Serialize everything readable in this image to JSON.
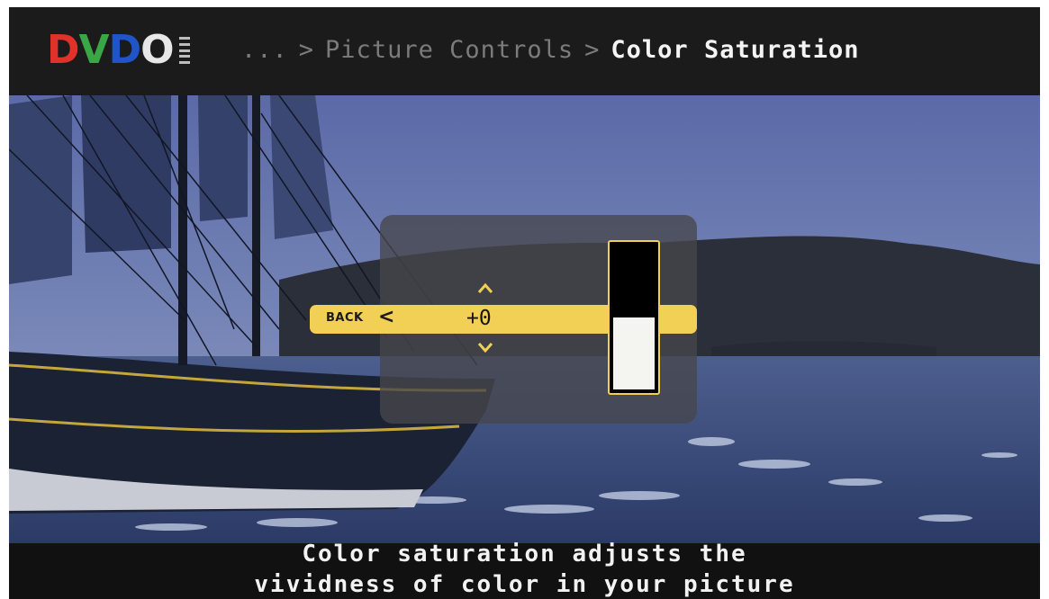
{
  "header": {
    "logo": {
      "letters": [
        {
          "char": "D",
          "color": "#e0312b"
        },
        {
          "char": "V",
          "color": "#3aa646"
        },
        {
          "char": "D",
          "color": "#1f55c9"
        },
        {
          "char": "O",
          "color": "#e8e8e8"
        }
      ]
    },
    "breadcrumb": {
      "ellipsis": "...",
      "separator": ">",
      "parent": "Picture Controls",
      "current": "Color Saturation"
    }
  },
  "dialog": {
    "back_label": "BACK",
    "back_icon": "chevron-left-icon",
    "value": "+0",
    "up_icon": "chevron-up-icon",
    "down_icon": "chevron-down-icon",
    "level_fraction": 0.5,
    "accent_color": "#f2cf55"
  },
  "caption": {
    "line1": "Color saturation adjusts the",
    "line2": "vividness of color in your picture"
  }
}
